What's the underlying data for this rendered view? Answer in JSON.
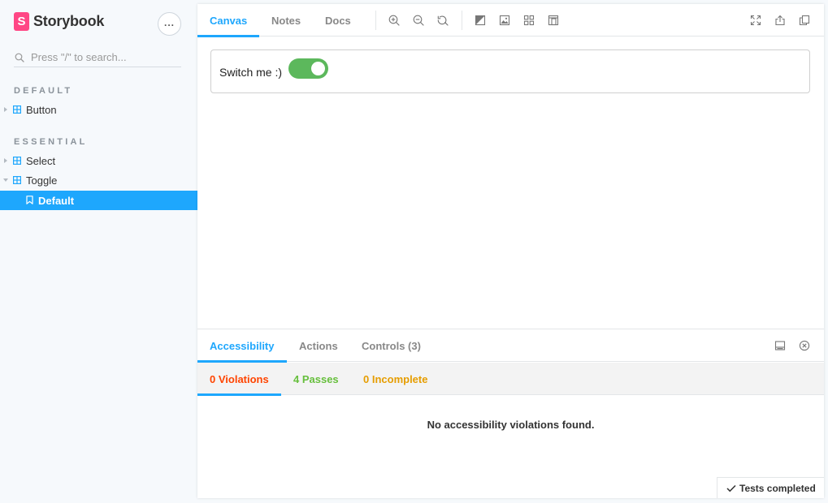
{
  "brand": {
    "name": "Storybook",
    "logo_letter": "S",
    "accent": "#ff4785"
  },
  "search": {
    "placeholder": "Press \"/\" to search..."
  },
  "sidebar": {
    "sections": [
      {
        "title": "DEFAULT",
        "items": [
          {
            "label": "Button"
          }
        ]
      },
      {
        "title": "ESSENTIAL",
        "items": [
          {
            "label": "Select"
          },
          {
            "label": "Toggle"
          }
        ]
      }
    ],
    "selected_story": "Default"
  },
  "toolbar": {
    "tabs": [
      {
        "label": "Canvas"
      },
      {
        "label": "Notes"
      },
      {
        "label": "Docs"
      }
    ],
    "active_tab": "Canvas",
    "icons": [
      "zoom-in-icon",
      "zoom-out-icon",
      "zoom-reset-icon",
      "background-icon",
      "grid-icon",
      "outline-icon",
      "viewport-icon",
      "fullscreen-icon",
      "share-icon",
      "copy-link-icon"
    ]
  },
  "canvas": {
    "story_label": "Switch me :)",
    "toggle_on": true,
    "toggle_color": "#5cb85c"
  },
  "addons": {
    "tabs": [
      {
        "label": "Accessibility"
      },
      {
        "label": "Actions"
      },
      {
        "label": "Controls (3)"
      }
    ],
    "active_tab": "Accessibility",
    "subtabs": {
      "violations": "0 Violations",
      "passes": "4 Passes",
      "incomplete": "0 Incomplete"
    },
    "message": "No accessibility violations found.",
    "status": "Tests completed"
  },
  "colors": {
    "accent": "#1ea7fd",
    "violations": "#ff4400",
    "passes": "#66bf3c",
    "incomplete": "#e69d00"
  }
}
